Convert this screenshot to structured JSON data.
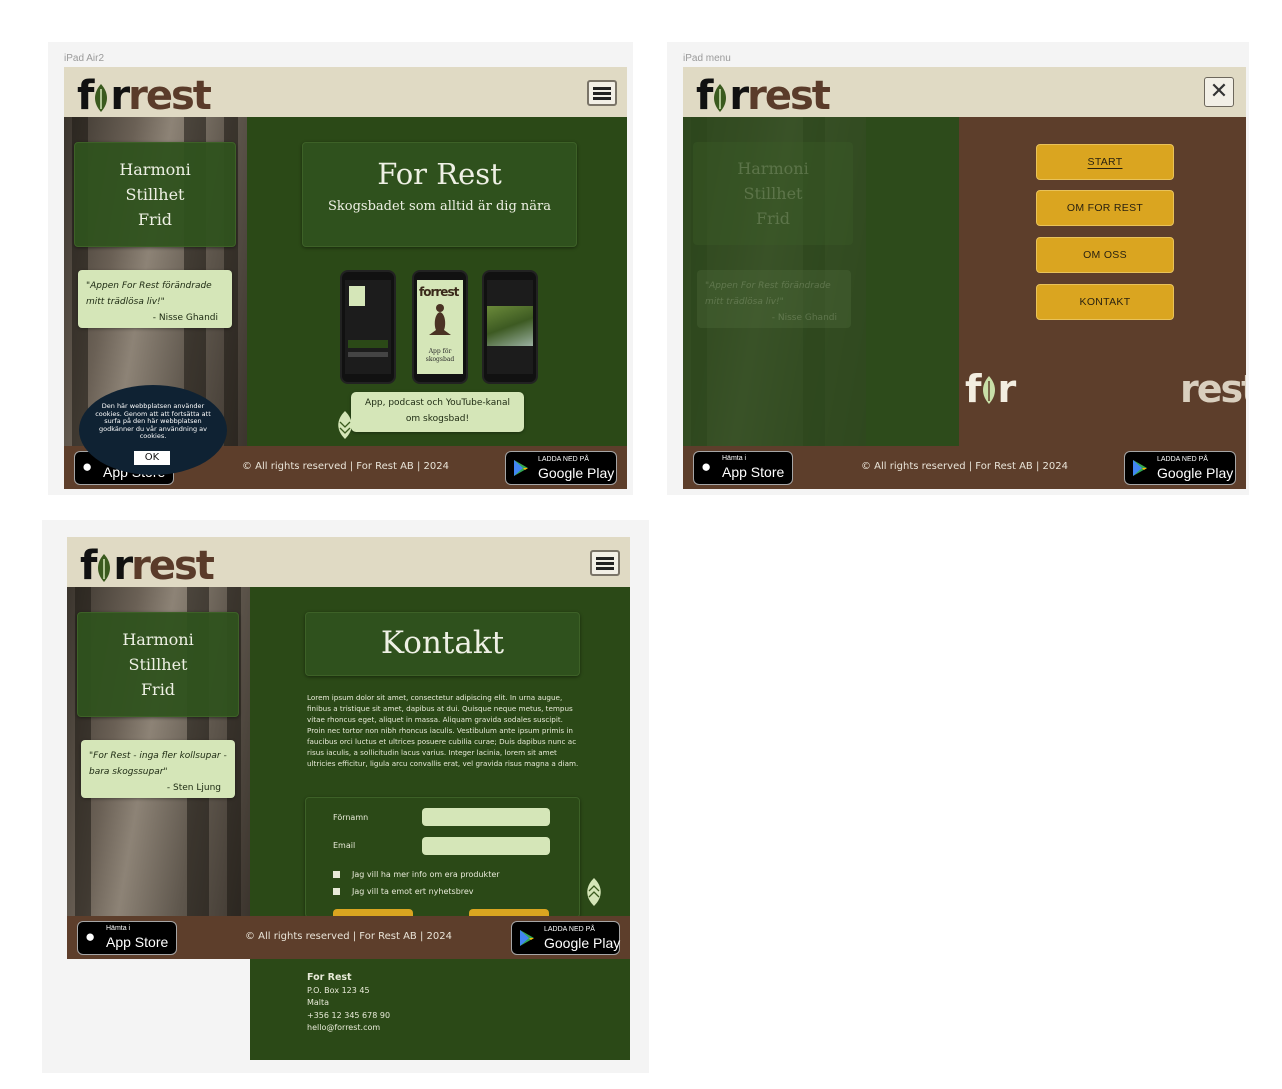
{
  "brand": {
    "logo_prefix": "f",
    "logo_middle": "r",
    "logo_suffix": "rest"
  },
  "frames": {
    "ipad": {
      "label": "iPad Air2"
    },
    "menu": {
      "label": "iPad menu"
    }
  },
  "taglines": [
    "Harmoni",
    "Stillhet",
    "Frid"
  ],
  "home": {
    "title": "For Rest",
    "subtitle": "Skogsbadet som alltid är dig nära",
    "quote": "\"Appen For Rest förändrade mitt trädlösa liv!\"",
    "quote_author": "- Nisse Ghandi",
    "bubble": "App, podcast och YouTube-kanal om skogsbad!",
    "phone_logo": "forrest",
    "phone_caption": "App för skogsbad",
    "cookie_text": "Den här webbplatsen använder cookies. Genom att att fortsätta att surfa på den här webbplatsen godkänner du vår användning av cookies.",
    "cookie_ok": "OK"
  },
  "menu": {
    "items": [
      "START",
      "OM FOR REST",
      "OM OSS",
      "KONTAKT"
    ],
    "close_glyph": "✕"
  },
  "contact": {
    "title": "Kontakt",
    "quote": "\"For Rest - inga fler kollsupar - bara skogssupar\"",
    "quote_author": "- Sten Ljung",
    "lorem": "Lorem ipsum dolor sit amet, consectetur adipiscing elit. In urna augue, finibus a tristique sit amet, dapibus at dui. Quisque neque metus, tempus vitae rhoncus eget, aliquet in massa. Aliquam gravida sodales suscipit. Proin nec tortor non nibh rhoncus iaculis. Vestibulum ante ipsum primis in faucibus orci luctus et ultrices posuere cubilia curae; Duis dapibus nunc ac risus iaculis, a sollicitudin lacus varius. Integer lacinia, lorem sit amet ultricies efficitur, ligula arcu convallis erat, vel gravida risus magna a diam.",
    "form": {
      "first_name_label": "Förnamn",
      "email_label": "Email",
      "check1": "Jag vill ha mer info om era produkter",
      "check2": "Jag vill ta emot ert nyhetsbrev"
    },
    "address": {
      "company": "For Rest",
      "box": "P.O. Box 123 45",
      "country": "Malta",
      "phone": "+356 12 345 678 90",
      "email": "hello@forrest.com"
    }
  },
  "footer": {
    "copyright": "© All rights reserved | For Rest AB | 2024",
    "appstore_small": "Hämta i",
    "appstore_big": "App Store",
    "play_small": "LADDA NED PÅ",
    "play_big": "Google Play"
  },
  "colors": {
    "header": "#e0dac4",
    "green": "#2b4917",
    "brown": "#5d3e2b",
    "gold": "#daa520",
    "light_green": "#d5e6b8"
  }
}
